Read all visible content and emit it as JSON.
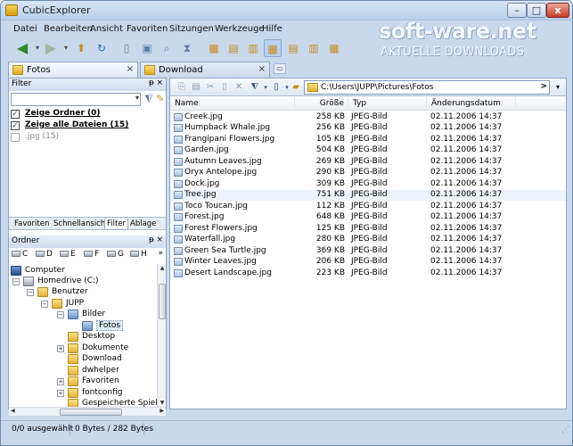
{
  "window": {
    "title": "CubicExplorer",
    "min": "–",
    "max": "□",
    "close": "x"
  },
  "menu": [
    "Datei",
    "Bearbeiten",
    "Ansicht",
    "Favoriten",
    "Sitzungen",
    "Werkzeuge",
    "Hilfe"
  ],
  "logo": {
    "main": "soft-ware.net",
    "sub": "AKTUELLE DOWNLOADS"
  },
  "tabs": [
    {
      "label": "Fotos",
      "close": "×"
    },
    {
      "label": "Download",
      "close": "×"
    }
  ],
  "filter_panel": {
    "title": "Filter",
    "pin": "ᵽ",
    "close": "×",
    "input_value": "",
    "dropdown": "▾",
    "options": [
      {
        "label": "Zeige Ordner (0)",
        "checked": true,
        "mark": "✓"
      },
      {
        "label": "Zeige alle Dateien (15)",
        "checked": true,
        "mark": "✓"
      },
      {
        "label": ".jpg (15)",
        "checked": false,
        "mark": ""
      }
    ]
  },
  "bottom_tabs": [
    "Favoriten",
    "Schnellansicht",
    "Filter",
    "Ablage"
  ],
  "folder_panel": {
    "title": "Ordner",
    "pin": "ᵽ",
    "close": "×",
    "more": "»",
    "drives": [
      "C",
      "D",
      "E",
      "F",
      "G",
      "H"
    ],
    "tree": [
      {
        "label": "Computer",
        "level": 0,
        "expander": "",
        "icon": "pc"
      },
      {
        "label": "Homedrive (C:)",
        "level": 1,
        "expander": "−",
        "icon": "hd"
      },
      {
        "label": "Benutzer",
        "level": 2,
        "expander": "−",
        "icon": "folder"
      },
      {
        "label": "JUPP",
        "level": 3,
        "expander": "−",
        "icon": "folder"
      },
      {
        "label": "Bilder",
        "level": 4,
        "expander": "−",
        "icon": "pic"
      },
      {
        "label": "Fotos",
        "level": 5,
        "expander": "",
        "icon": "folder",
        "selected": true
      },
      {
        "label": "Desktop",
        "level": 4,
        "expander": "",
        "icon": "folder"
      },
      {
        "label": "Dokumente",
        "level": 4,
        "expander": "+",
        "icon": "folder"
      },
      {
        "label": "Download",
        "level": 4,
        "expander": "",
        "icon": "folder"
      },
      {
        "label": "dwhelper",
        "level": 4,
        "expander": "",
        "icon": "folder"
      },
      {
        "label": "Favoriten",
        "level": 4,
        "expander": "+",
        "icon": "folder"
      },
      {
        "label": "fontconfig",
        "level": 4,
        "expander": "+",
        "icon": "folder"
      },
      {
        "label": "Gespeicherte Spiele",
        "level": 4,
        "expander": "",
        "icon": "folder"
      }
    ]
  },
  "address": {
    "path": "C:\\Users\\JUPP\\Pictures\\Fotos",
    "go": ">",
    "dropdown": "▾"
  },
  "columns": {
    "name": "Name",
    "size": "Größe",
    "type": "Typ",
    "date": "Änderungsdatum"
  },
  "files": [
    {
      "name": "Creek.jpg",
      "size": "258 KB",
      "type": "JPEG-Bild",
      "date": "02.11.2006 14:37"
    },
    {
      "name": "Humpback Whale.jpg",
      "size": "256 KB",
      "type": "JPEG-Bild",
      "date": "02.11.2006 14:37"
    },
    {
      "name": "Frangipani Flowers.jpg",
      "size": "105 KB",
      "type": "JPEG-Bild",
      "date": "02.11.2006 14:37"
    },
    {
      "name": "Garden.jpg",
      "size": "504 KB",
      "type": "JPEG-Bild",
      "date": "02.11.2006 14:37"
    },
    {
      "name": "Autumn Leaves.jpg",
      "size": "269 KB",
      "type": "JPEG-Bild",
      "date": "02.11.2006 14:37"
    },
    {
      "name": "Oryx Antelope.jpg",
      "size": "290 KB",
      "type": "JPEG-Bild",
      "date": "02.11.2006 14:37"
    },
    {
      "name": "Dock.jpg",
      "size": "309 KB",
      "type": "JPEG-Bild",
      "date": "02.11.2006 14:37"
    },
    {
      "name": "Tree.jpg",
      "size": "751 KB",
      "type": "JPEG-Bild",
      "date": "02.11.2006 14:37"
    },
    {
      "name": "Toco Toucan.jpg",
      "size": "112 KB",
      "type": "JPEG-Bild",
      "date": "02.11.2006 14:37"
    },
    {
      "name": "Forest.jpg",
      "size": "648 KB",
      "type": "JPEG-Bild",
      "date": "02.11.2006 14:37"
    },
    {
      "name": "Forest Flowers.jpg",
      "size": "125 KB",
      "type": "JPEG-Bild",
      "date": "02.11.2006 14:37"
    },
    {
      "name": "Waterfall.jpg",
      "size": "280 KB",
      "type": "JPEG-Bild",
      "date": "02.11.2006 14:37"
    },
    {
      "name": "Green Sea Turtle.jpg",
      "size": "369 KB",
      "type": "JPEG-Bild",
      "date": "02.11.2006 14:37"
    },
    {
      "name": "Winter Leaves.jpg",
      "size": "206 KB",
      "type": "JPEG-Bild",
      "date": "02.11.2006 14:37"
    },
    {
      "name": "Desert Landscape.jpg",
      "size": "223 KB",
      "type": "JPEG-Bild",
      "date": "02.11.2006 14:37"
    }
  ],
  "status": {
    "selected": "0/0 ausgewählt",
    "bytes": "0 Bytes / 282 Bytes"
  }
}
